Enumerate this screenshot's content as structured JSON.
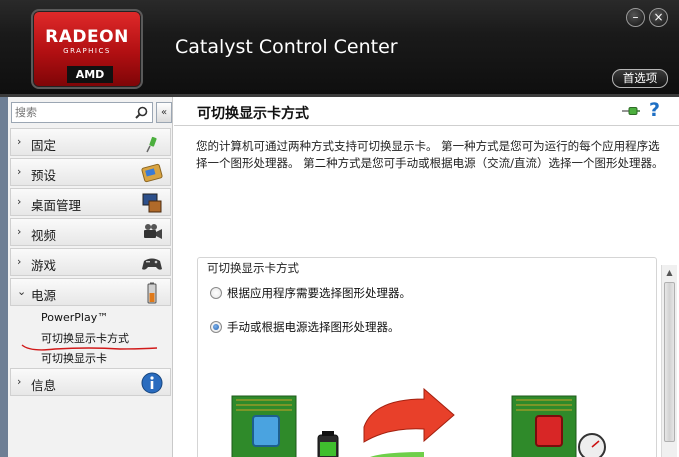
{
  "window": {
    "title": "Catalyst Control Center",
    "minimize_label": "–",
    "close_label": "×",
    "preferences_label": "首选项"
  },
  "logo": {
    "brand": "RADEON",
    "subtitle": "GRAPHICS",
    "vendor": "AMD"
  },
  "sidebar": {
    "search_placeholder": "搜索",
    "collapse_label": "«",
    "items": [
      {
        "label": "固定",
        "icon": "pin-icon",
        "expanded": false
      },
      {
        "label": "预设",
        "icon": "preset-icon",
        "expanded": false
      },
      {
        "label": "桌面管理",
        "icon": "desktop-management-icon",
        "expanded": false
      },
      {
        "label": "视频",
        "icon": "video-camera-icon",
        "expanded": false
      },
      {
        "label": "游戏",
        "icon": "gamepad-icon",
        "expanded": false
      },
      {
        "label": "电源",
        "icon": "battery-icon",
        "expanded": true
      },
      {
        "label": "信息",
        "icon": "info-icon",
        "expanded": false
      }
    ],
    "power_subitems": [
      "PowerPlay™",
      "可切换显示卡方式",
      "可切换显示卡"
    ]
  },
  "main": {
    "title": "可切换显示卡方式",
    "description": "您的计算机可通过两种方式支持可切换显示卡。 第一种方式是您可为运行的每个应用程序选择一个图形处理器。 第二种方式是您可手动或根据电源（交流/直流）选择一个图形处理器。",
    "group_title": "可切换显示卡方式",
    "options": [
      {
        "label": "根据应用程序需要选择图形处理器。",
        "checked": false
      },
      {
        "label": "手动或根据电源选择图形处理器。",
        "checked": true
      }
    ]
  },
  "colors": {
    "header_bg": "#121212",
    "logo_red": "#c4161c",
    "annotation_red": "#d11a1a",
    "chip_green": "#2f8a2a"
  }
}
